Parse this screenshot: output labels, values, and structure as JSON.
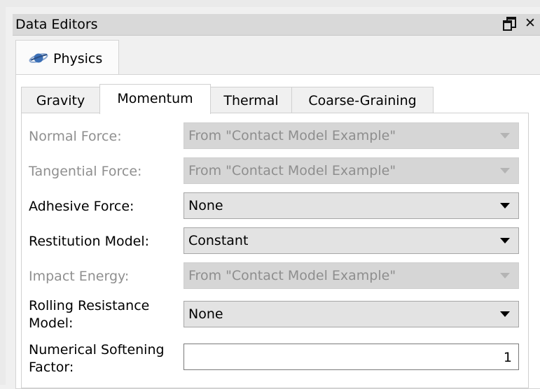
{
  "window": {
    "title": "Data Editors"
  },
  "outer_tab": {
    "label": "Physics",
    "icon": "planet-icon"
  },
  "inner_tabs": [
    {
      "label": "Gravity",
      "active": false
    },
    {
      "label": "Momentum",
      "active": true
    },
    {
      "label": "Thermal",
      "active": false
    },
    {
      "label": "Coarse-Graining",
      "active": false
    }
  ],
  "rows": {
    "normal_force": {
      "label": "Normal Force:",
      "value": "From \"Contact Model Example\"",
      "enabled": false
    },
    "tangential_force": {
      "label": "Tangential Force:",
      "value": "From \"Contact Model Example\"",
      "enabled": false
    },
    "adhesive_force": {
      "label": "Adhesive Force:",
      "value": "None",
      "enabled": true
    },
    "restitution_model": {
      "label": "Restitution Model:",
      "value": "Constant",
      "enabled": true
    },
    "impact_energy": {
      "label": "Impact Energy:",
      "value": "From \"Contact Model Example\"",
      "enabled": false
    },
    "rolling_resistance": {
      "label_line1": "Rolling Resistance",
      "label_line2": "Model:",
      "value": "None",
      "enabled": true
    },
    "numerical_softening": {
      "label_line1": "Numerical Softening",
      "label_line2": "Factor:",
      "value": "1",
      "enabled": true
    }
  },
  "colors": {
    "disabled_text": "#8f8f8f",
    "combo_bg": "#e3e3e3",
    "planet_blue": "#3b6fb6"
  }
}
